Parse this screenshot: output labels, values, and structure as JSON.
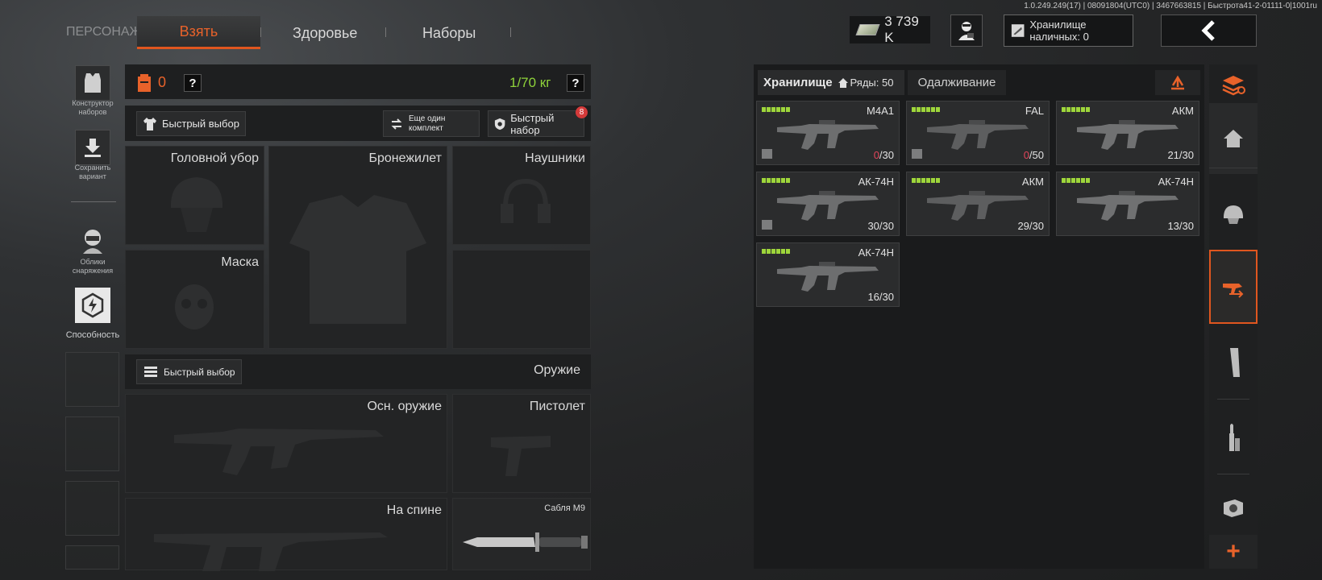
{
  "version_string": "1.0.249.249(17) | 08091804(UTC0) | 3467663815 | Быстрота41-2-01111-0|1001ru",
  "nav": {
    "section": "ПЕРСОНАЖ",
    "tabs": [
      "Взять",
      "Здоровье",
      "Наборы"
    ],
    "active_tab": "Взять"
  },
  "header": {
    "money": "3 739 K",
    "cash_storage_label": "Хранилище наличных: 0"
  },
  "left_sidebar": {
    "kit_builder_label": "Конструктор наборов",
    "save_variant_label": "Сохранить вариант",
    "gear_skins_label": "Облики снаряжения",
    "ability_label": "Способность"
  },
  "gear": {
    "backpack_count": "0",
    "weight": "1/70 кг",
    "quick_select_label": "Быстрый выбор",
    "another_kit_label": "Еще один комплект",
    "quick_kit_label": "Быстрый набор",
    "quick_kit_badge": "8",
    "slots": {
      "headwear": "Головной убор",
      "vest": "Бронежилет",
      "headphones": "Наушники",
      "mask": "Маска"
    }
  },
  "weapons": {
    "quick_select_label": "Быстрый выбор",
    "title": "Оружие",
    "slots": {
      "primary": "Осн. оружие",
      "pistol": "Пистолет",
      "back": "На спине",
      "melee": "Сабля M9"
    }
  },
  "storage": {
    "tab_label": "Хранилище",
    "rows_label": "Ряды: 50",
    "lending_tab": "Одалживание",
    "items": [
      {
        "name": "M4A1",
        "ammo_cur": "0",
        "ammo_max": "/30",
        "ammo_low": true,
        "boxed": true
      },
      {
        "name": "FAL",
        "ammo_cur": "0",
        "ammo_max": "/50",
        "ammo_low": true,
        "boxed": true
      },
      {
        "name": "АКМ",
        "ammo_cur": "21",
        "ammo_max": "/30",
        "ammo_low": false,
        "boxed": false
      },
      {
        "name": "АК-74Н",
        "ammo_cur": "30",
        "ammo_max": "/30",
        "ammo_low": false,
        "boxed": true
      },
      {
        "name": "АКМ",
        "ammo_cur": "29",
        "ammo_max": "/30",
        "ammo_low": false,
        "boxed": false
      },
      {
        "name": "АК-74Н",
        "ammo_cur": "13",
        "ammo_max": "/30",
        "ammo_low": false,
        "boxed": false
      },
      {
        "name": "АК-74Н",
        "ammo_cur": "16",
        "ammo_max": "/30",
        "ammo_low": false,
        "boxed": false
      }
    ]
  },
  "right_sidebar": {
    "add_label": "+"
  },
  "colors": {
    "accent": "#e8622a",
    "weight_green": "#8fd33a",
    "durability_green": "#9ed63b",
    "ammo_low_red": "#e2455a"
  },
  "icons": [
    "cash-icon",
    "agent-icon",
    "wallet-icon",
    "back-arrow-icon",
    "vest-icon",
    "download-icon",
    "gear-skin-icon",
    "ability-icon",
    "backpack-icon",
    "help-icon",
    "shirt-icon",
    "swap-icon",
    "shield-icon",
    "ammo-icon",
    "home-icon",
    "transfer-icon",
    "stack-icon",
    "helmet-icon",
    "take-weapon-icon",
    "magazine-icon",
    "bullet-icon",
    "scope-icon",
    "plus-icon"
  ]
}
